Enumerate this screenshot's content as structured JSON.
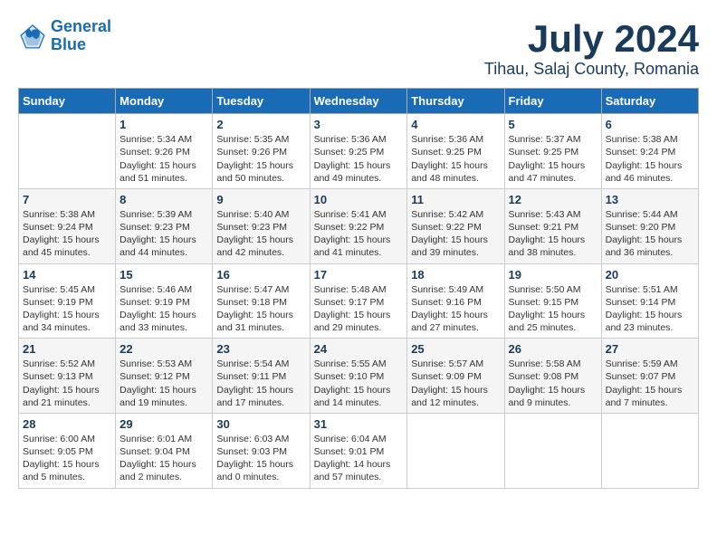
{
  "header": {
    "logo_line1": "General",
    "logo_line2": "Blue",
    "month_year": "July 2024",
    "location": "Tihau, Salaj County, Romania"
  },
  "weekdays": [
    "Sunday",
    "Monday",
    "Tuesday",
    "Wednesday",
    "Thursday",
    "Friday",
    "Saturday"
  ],
  "weeks": [
    [
      {
        "day": "",
        "info": ""
      },
      {
        "day": "1",
        "info": "Sunrise: 5:34 AM\nSunset: 9:26 PM\nDaylight: 15 hours\nand 51 minutes."
      },
      {
        "day": "2",
        "info": "Sunrise: 5:35 AM\nSunset: 9:26 PM\nDaylight: 15 hours\nand 50 minutes."
      },
      {
        "day": "3",
        "info": "Sunrise: 5:36 AM\nSunset: 9:25 PM\nDaylight: 15 hours\nand 49 minutes."
      },
      {
        "day": "4",
        "info": "Sunrise: 5:36 AM\nSunset: 9:25 PM\nDaylight: 15 hours\nand 48 minutes."
      },
      {
        "day": "5",
        "info": "Sunrise: 5:37 AM\nSunset: 9:25 PM\nDaylight: 15 hours\nand 47 minutes."
      },
      {
        "day": "6",
        "info": "Sunrise: 5:38 AM\nSunset: 9:24 PM\nDaylight: 15 hours\nand 46 minutes."
      }
    ],
    [
      {
        "day": "7",
        "info": "Sunrise: 5:38 AM\nSunset: 9:24 PM\nDaylight: 15 hours\nand 45 minutes."
      },
      {
        "day": "8",
        "info": "Sunrise: 5:39 AM\nSunset: 9:23 PM\nDaylight: 15 hours\nand 44 minutes."
      },
      {
        "day": "9",
        "info": "Sunrise: 5:40 AM\nSunset: 9:23 PM\nDaylight: 15 hours\nand 42 minutes."
      },
      {
        "day": "10",
        "info": "Sunrise: 5:41 AM\nSunset: 9:22 PM\nDaylight: 15 hours\nand 41 minutes."
      },
      {
        "day": "11",
        "info": "Sunrise: 5:42 AM\nSunset: 9:22 PM\nDaylight: 15 hours\nand 39 minutes."
      },
      {
        "day": "12",
        "info": "Sunrise: 5:43 AM\nSunset: 9:21 PM\nDaylight: 15 hours\nand 38 minutes."
      },
      {
        "day": "13",
        "info": "Sunrise: 5:44 AM\nSunset: 9:20 PM\nDaylight: 15 hours\nand 36 minutes."
      }
    ],
    [
      {
        "day": "14",
        "info": "Sunrise: 5:45 AM\nSunset: 9:19 PM\nDaylight: 15 hours\nand 34 minutes."
      },
      {
        "day": "15",
        "info": "Sunrise: 5:46 AM\nSunset: 9:19 PM\nDaylight: 15 hours\nand 33 minutes."
      },
      {
        "day": "16",
        "info": "Sunrise: 5:47 AM\nSunset: 9:18 PM\nDaylight: 15 hours\nand 31 minutes."
      },
      {
        "day": "17",
        "info": "Sunrise: 5:48 AM\nSunset: 9:17 PM\nDaylight: 15 hours\nand 29 minutes."
      },
      {
        "day": "18",
        "info": "Sunrise: 5:49 AM\nSunset: 9:16 PM\nDaylight: 15 hours\nand 27 minutes."
      },
      {
        "day": "19",
        "info": "Sunrise: 5:50 AM\nSunset: 9:15 PM\nDaylight: 15 hours\nand 25 minutes."
      },
      {
        "day": "20",
        "info": "Sunrise: 5:51 AM\nSunset: 9:14 PM\nDaylight: 15 hours\nand 23 minutes."
      }
    ],
    [
      {
        "day": "21",
        "info": "Sunrise: 5:52 AM\nSunset: 9:13 PM\nDaylight: 15 hours\nand 21 minutes."
      },
      {
        "day": "22",
        "info": "Sunrise: 5:53 AM\nSunset: 9:12 PM\nDaylight: 15 hours\nand 19 minutes."
      },
      {
        "day": "23",
        "info": "Sunrise: 5:54 AM\nSunset: 9:11 PM\nDaylight: 15 hours\nand 17 minutes."
      },
      {
        "day": "24",
        "info": "Sunrise: 5:55 AM\nSunset: 9:10 PM\nDaylight: 15 hours\nand 14 minutes."
      },
      {
        "day": "25",
        "info": "Sunrise: 5:57 AM\nSunset: 9:09 PM\nDaylight: 15 hours\nand 12 minutes."
      },
      {
        "day": "26",
        "info": "Sunrise: 5:58 AM\nSunset: 9:08 PM\nDaylight: 15 hours\nand 9 minutes."
      },
      {
        "day": "27",
        "info": "Sunrise: 5:59 AM\nSunset: 9:07 PM\nDaylight: 15 hours\nand 7 minutes."
      }
    ],
    [
      {
        "day": "28",
        "info": "Sunrise: 6:00 AM\nSunset: 9:05 PM\nDaylight: 15 hours\nand 5 minutes."
      },
      {
        "day": "29",
        "info": "Sunrise: 6:01 AM\nSunset: 9:04 PM\nDaylight: 15 hours\nand 2 minutes."
      },
      {
        "day": "30",
        "info": "Sunrise: 6:03 AM\nSunset: 9:03 PM\nDaylight: 15 hours\nand 0 minutes."
      },
      {
        "day": "31",
        "info": "Sunrise: 6:04 AM\nSunset: 9:01 PM\nDaylight: 14 hours\nand 57 minutes."
      },
      {
        "day": "",
        "info": ""
      },
      {
        "day": "",
        "info": ""
      },
      {
        "day": "",
        "info": ""
      }
    ]
  ]
}
